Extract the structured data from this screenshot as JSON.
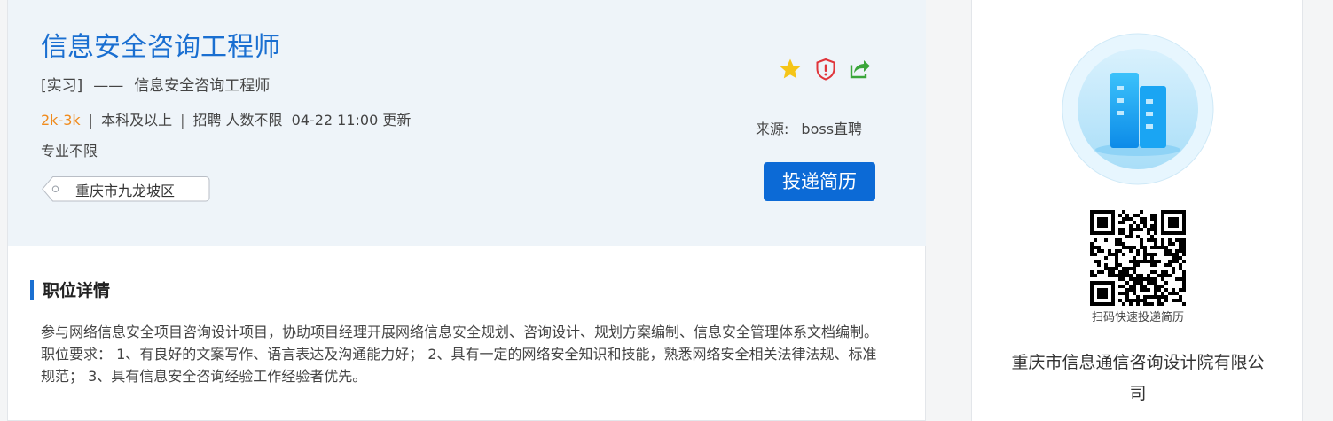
{
  "job": {
    "title": "信息安全咨询工程师",
    "type": "[实习]",
    "dash": "——",
    "subtitle": "信息安全咨询工程师",
    "salary": "2k-3k",
    "education": "本科及以上",
    "headcount": "招聘 人数不限",
    "updated": "04-22 11:00 更新",
    "separator": "|",
    "major": "专业不限",
    "location": "重庆市九龙坡区"
  },
  "actions": {
    "favorite_icon": "star-icon",
    "report_icon": "shield-alert-icon",
    "share_icon": "share-icon",
    "source_label": "来源:",
    "source_value": "boss直聘",
    "apply_label": "投递简历"
  },
  "details": {
    "section_title": "职位详情",
    "description": "参与网络信息安全项目咨询设计项目，协助项目经理开展网络信息安全规划、咨询设计、规划方案编制、信息安全管理体系文档编制。 职位要求： 1、有良好的文案写作、语言表达及沟通能力好； 2、具有一定的网络安全知识和技能，熟悉网络安全相关法律法规、标准规范； 3、具有信息安全咨询经验工作经验者优先。"
  },
  "company": {
    "logo_icon": "building-logo-icon",
    "qr_caption": "扫码快速投递简历",
    "name": "重庆市信息通信咨询设计院有限公司"
  },
  "colors": {
    "title_blue": "#1a6fd1",
    "salary_orange": "#f08b1d",
    "apply_blue": "#0c6ad6",
    "star_yellow": "#f5c518",
    "report_red": "#e0353b",
    "share_green": "#3aa63a"
  }
}
